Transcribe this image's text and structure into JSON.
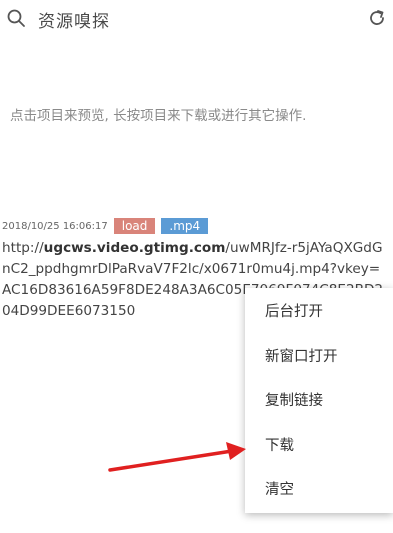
{
  "header": {
    "title": "资源嗅探",
    "search_icon": "search-icon",
    "refresh_icon": "refresh-icon"
  },
  "hint": "点击项目来预览, 长按项目来下载或进行其它操作.",
  "entry": {
    "timestamp": "2018/10/25 16:06:17",
    "badge_load": "load",
    "badge_type": ".mp4",
    "url_prefix": "http://",
    "url_host": "ugcws.video.gtimg.com",
    "url_rest": "/uwMRJfz-r5jAYaQXGdGnC2_ppdhgmrDlPaRvaV7F2lc/x0671r0mu4j.mp4?vkey=AC16D83616A59F8DE248A3A6C05E7069F074C8E2BD204D99DEE6073150"
  },
  "context_menu": {
    "items": [
      "后台打开",
      "新窗口打开",
      "复制链接",
      "下载",
      "清空"
    ]
  },
  "colors": {
    "badge_load": "#d9847a",
    "badge_type": "#5b9bd5",
    "arrow": "#e02020"
  }
}
